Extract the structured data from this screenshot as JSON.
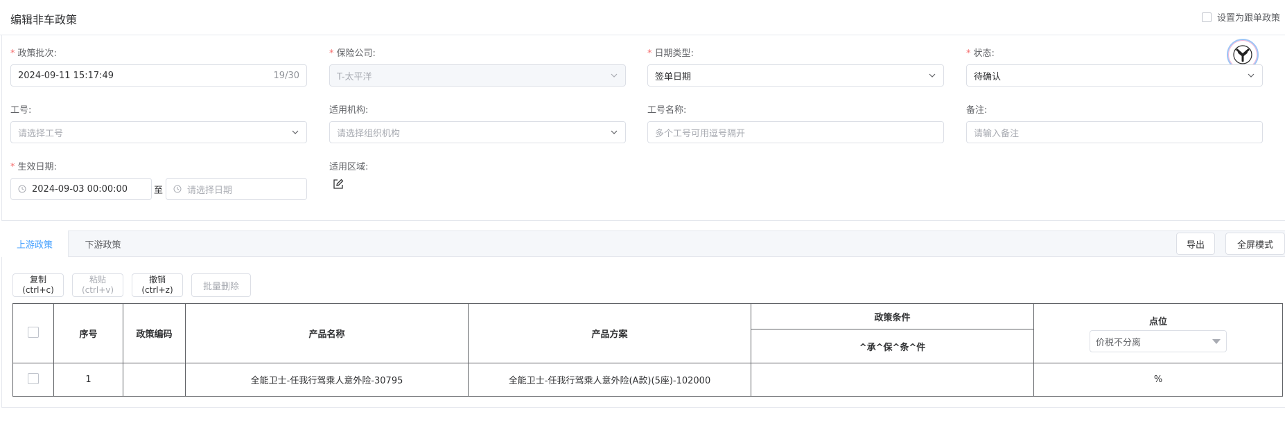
{
  "header": {
    "title": "编辑非车政策",
    "follow_label": "设置为跟单政策"
  },
  "form": {
    "batch": {
      "label": "政策批次:",
      "value": "2024-09-11 15:17:49",
      "count": "19/30"
    },
    "insurer": {
      "label": "保险公司:",
      "value": "T-太平洋"
    },
    "date_type": {
      "label": "日期类型:",
      "value": "签单日期"
    },
    "status": {
      "label": "状态:",
      "value": "待确认"
    },
    "job_no": {
      "label": "工号:",
      "placeholder": "请选择工号"
    },
    "org": {
      "label": "适用机构:",
      "placeholder": "请选择组织机构"
    },
    "job_name": {
      "label": "工号名称:",
      "placeholder": "多个工号可用逗号隔开"
    },
    "remark": {
      "label": "备注:",
      "placeholder": "请输入备注"
    },
    "effective": {
      "label": "生效日期:",
      "start": "2024-09-03 00:00:00",
      "sep": "至",
      "end_placeholder": "请选择日期"
    },
    "region": {
      "label": "适用区域:"
    }
  },
  "tabs": [
    {
      "label": "上游政策",
      "active": true
    },
    {
      "label": "下游政策",
      "active": false
    }
  ],
  "toolbar": {
    "export": "导出",
    "fullscreen": "全屏模式",
    "copy": "复制",
    "copy_key": "(ctrl+c)",
    "paste": "粘贴",
    "paste_key": "(ctrl+v)",
    "undo": "撤销",
    "undo_key": "(ctrl+z)",
    "batch_delete": "批量删除"
  },
  "table": {
    "headers": {
      "index": "序号",
      "code": "政策编码",
      "product_name": "产品名称",
      "product_plan": "产品方案",
      "conditions": "政策条件",
      "condition_sub": "^承^保^条^件",
      "points": "点位",
      "points_select": "价税不分离"
    },
    "rows": [
      {
        "index": "1",
        "code": "",
        "product_name": "全能卫士-任我行驾乘人意外险-30795",
        "product_plan": "全能卫士-任我行驾乘人意外险(A款)(5座)-102000",
        "condition": "",
        "points": "%"
      }
    ]
  }
}
